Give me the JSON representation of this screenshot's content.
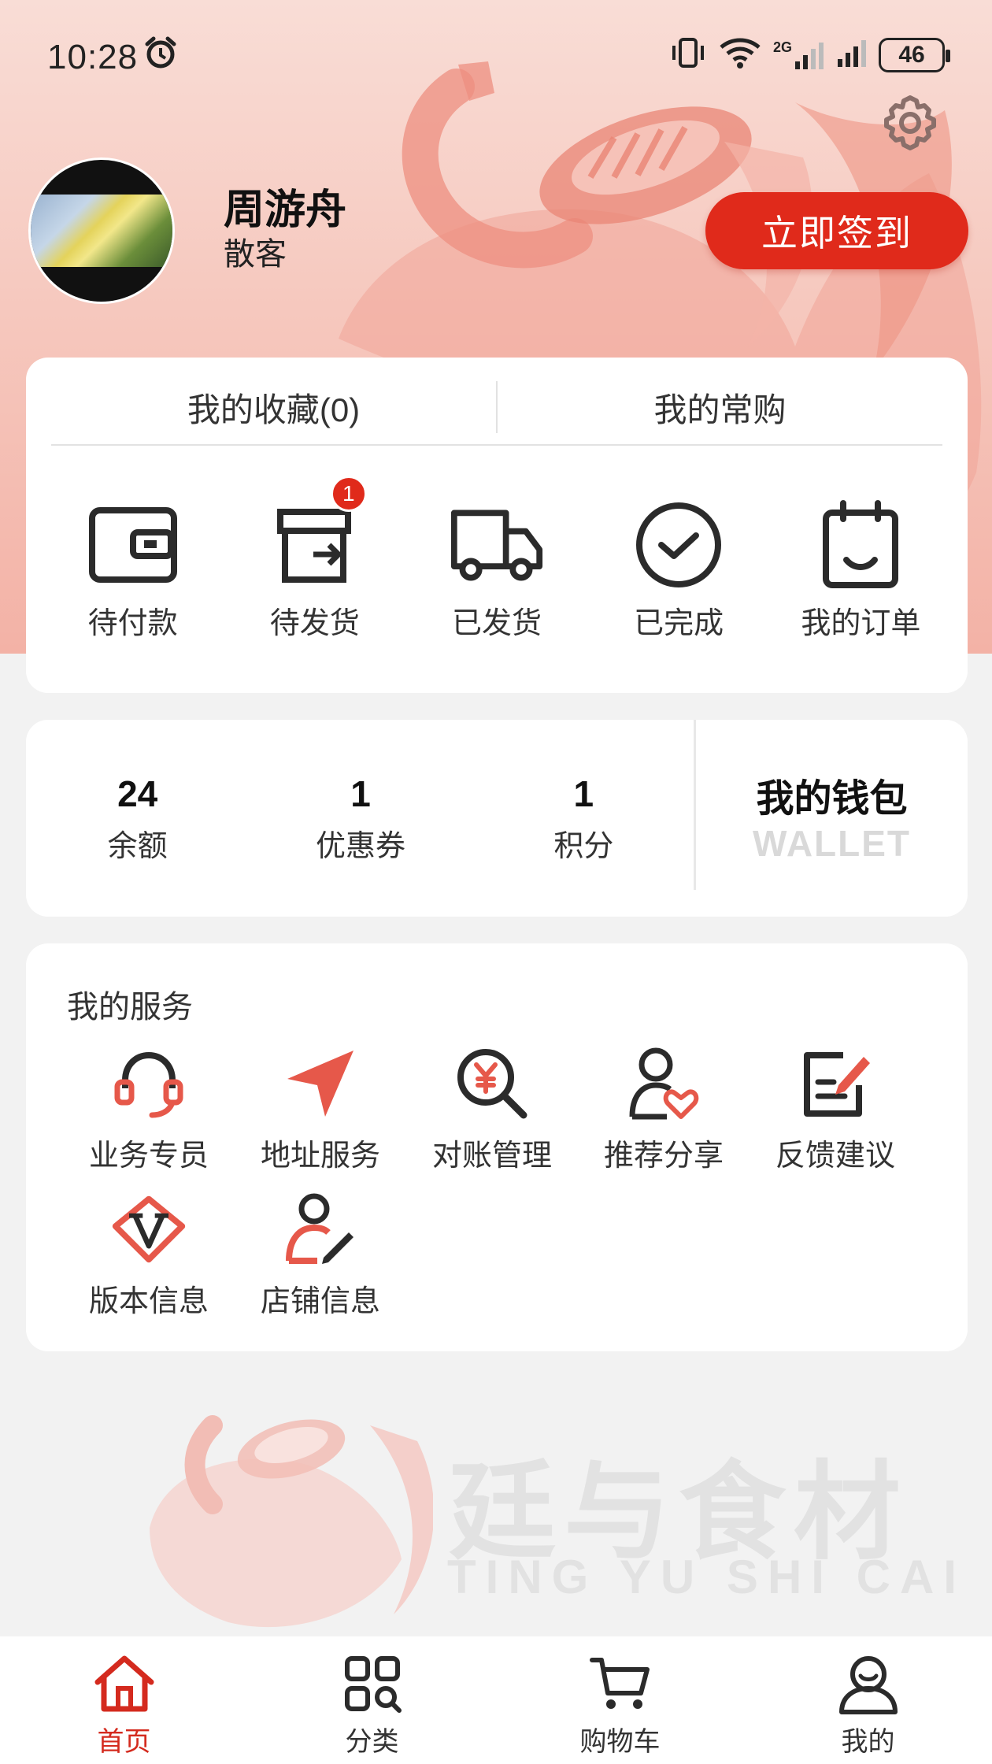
{
  "status_bar": {
    "time": "10:28",
    "battery": "46",
    "network_label": "2G"
  },
  "profile": {
    "name": "周游舟",
    "level": "散客",
    "checkin_label": "立即签到"
  },
  "tabs": [
    {
      "label": "我的收藏(0)"
    },
    {
      "label": "我的常购"
    }
  ],
  "orders": [
    {
      "label": "待付款",
      "icon": "wallet-icon"
    },
    {
      "label": "待发货",
      "icon": "box-icon",
      "badge": "1"
    },
    {
      "label": "已发货",
      "icon": "truck-icon"
    },
    {
      "label": "已完成",
      "icon": "check-circle-icon"
    },
    {
      "label": "我的订单",
      "icon": "clipboard-icon"
    }
  ],
  "wallet": {
    "stats": [
      {
        "value": "24",
        "label": "余额"
      },
      {
        "value": "1",
        "label": "优惠券"
      },
      {
        "value": "1",
        "label": "积分"
      }
    ],
    "title": "我的钱包",
    "subtitle": "WALLET"
  },
  "services": {
    "title": "我的服务",
    "items": [
      {
        "label": "业务专员",
        "icon": "headset-icon"
      },
      {
        "label": "地址服务",
        "icon": "navigation-arrow-icon"
      },
      {
        "label": "对账管理",
        "icon": "yuan-search-icon"
      },
      {
        "label": "推荐分享",
        "icon": "user-heart-icon"
      },
      {
        "label": "反馈建议",
        "icon": "edit-note-icon"
      },
      {
        "label": "版本信息",
        "icon": "version-diamond-icon"
      },
      {
        "label": "店铺信息",
        "icon": "user-edit-icon"
      }
    ]
  },
  "watermark": {
    "brand_cn": "廷与食材",
    "brand_en": "TING YU SHI CAI"
  },
  "bottom_nav": [
    {
      "label": "首页",
      "icon": "home-icon",
      "active": true
    },
    {
      "label": "分类",
      "icon": "category-grid-icon"
    },
    {
      "label": "购物车",
      "icon": "cart-icon"
    },
    {
      "label": "我的",
      "icon": "profile-icon"
    }
  ],
  "colors": {
    "accent": "#e02a1b",
    "icon_red": "#e6584a",
    "icon_dark": "#2b2b2b"
  }
}
